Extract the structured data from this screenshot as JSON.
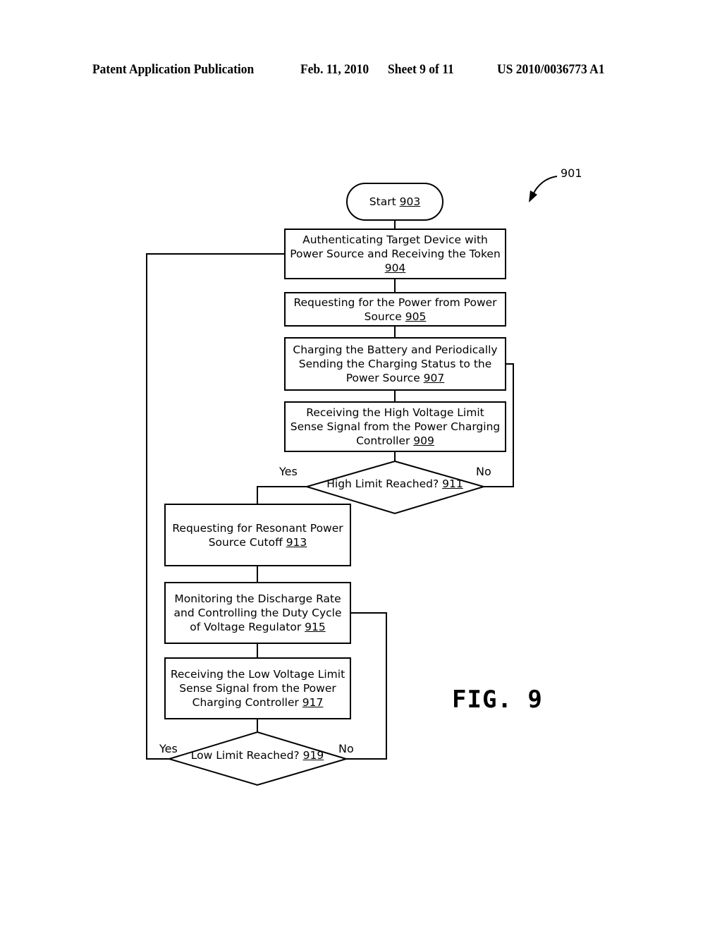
{
  "header": {
    "publication": "Patent Application Publication",
    "date": "Feb. 11, 2010",
    "sheet": "Sheet 9 of 11",
    "pub_number": "US 2010/0036773 A1"
  },
  "figure": {
    "ref_number": "901",
    "caption": "FIG. 9"
  },
  "nodes": {
    "start": {
      "text": "Start ",
      "ref": "903"
    },
    "n904": {
      "text": "Authenticating Target Device with Power Source and Receiving the Token",
      "ref": "904"
    },
    "n905": {
      "text": "Requesting  for the Power from Power Source ",
      "ref": "905"
    },
    "n907": {
      "text": "Charging the Battery and Periodically Sending the Charging Status to the Power Source ",
      "ref": "907"
    },
    "n909": {
      "text": "Receiving the High Voltage Limit Sense Signal from the Power Charging Controller ",
      "ref": "909"
    },
    "n911": {
      "text": "High Limit Reached?",
      "ref": "911",
      "yes": "Yes",
      "no": "No"
    },
    "n913": {
      "text": "Requesting for Resonant Power Source Cutoff ",
      "ref": "913"
    },
    "n915": {
      "text": "Monitoring the Discharge Rate and Controlling the Duty Cycle of Voltage Regulator ",
      "ref": "915"
    },
    "n917": {
      "text": "Receiving the Low Voltage Limit Sense Signal from the Power Charging Controller ",
      "ref": "917"
    },
    "n919": {
      "text": "Low Limit Reached?",
      "ref": "919",
      "yes": "Yes",
      "no": "No"
    }
  }
}
